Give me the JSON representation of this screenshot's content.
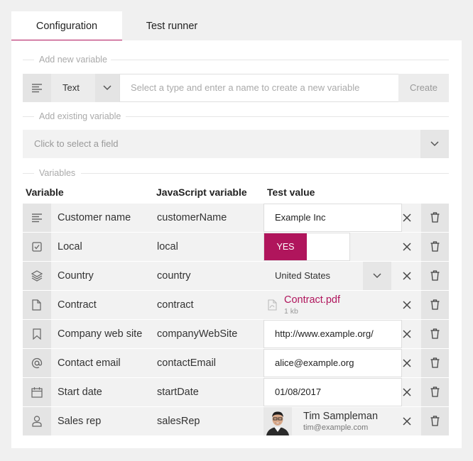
{
  "tabs": [
    {
      "label": "Configuration",
      "active": true
    },
    {
      "label": "Test runner",
      "active": false
    }
  ],
  "add_new": {
    "title": "Add new variable",
    "type_value": "Text",
    "name_placeholder": "Select a type and enter a name to create a new variable",
    "create_label": "Create"
  },
  "add_existing": {
    "title": "Add existing variable",
    "placeholder": "Click to select a field"
  },
  "variables": {
    "title": "Variables",
    "headers": {
      "variable": "Variable",
      "js": "JavaScript variable",
      "test": "Test value"
    },
    "rows": [
      {
        "icon": "text-lines-icon",
        "name": "Customer name",
        "js": "customerName",
        "test_kind": "text",
        "test_value": "Example Inc"
      },
      {
        "icon": "checkbox-icon",
        "name": "Local",
        "js": "local",
        "test_kind": "toggle",
        "test_value": "YES"
      },
      {
        "icon": "layers-icon",
        "name": "Country",
        "js": "country",
        "test_kind": "select",
        "test_value": "United States"
      },
      {
        "icon": "file-icon",
        "name": "Contract",
        "js": "contract",
        "test_kind": "file",
        "test_value": "Contract.pdf",
        "file_size": "1 kb"
      },
      {
        "icon": "bookmark-icon",
        "name": "Company web site",
        "js": "companyWebSite",
        "test_kind": "text",
        "test_value": "http://www.example.org/"
      },
      {
        "icon": "at-icon",
        "name": "Contact email",
        "js": "contactEmail",
        "test_kind": "text",
        "test_value": "alice@example.org"
      },
      {
        "icon": "calendar-icon",
        "name": "Start date",
        "js": "startDate",
        "test_kind": "text",
        "test_value": "01/08/2017"
      },
      {
        "icon": "person-icon",
        "name": "Sales rep",
        "js": "salesRep",
        "test_kind": "person",
        "test_value": "Tim Sampleman",
        "person_email": "tim@example.com"
      }
    ]
  },
  "colors": {
    "accent": "#b0155c"
  }
}
